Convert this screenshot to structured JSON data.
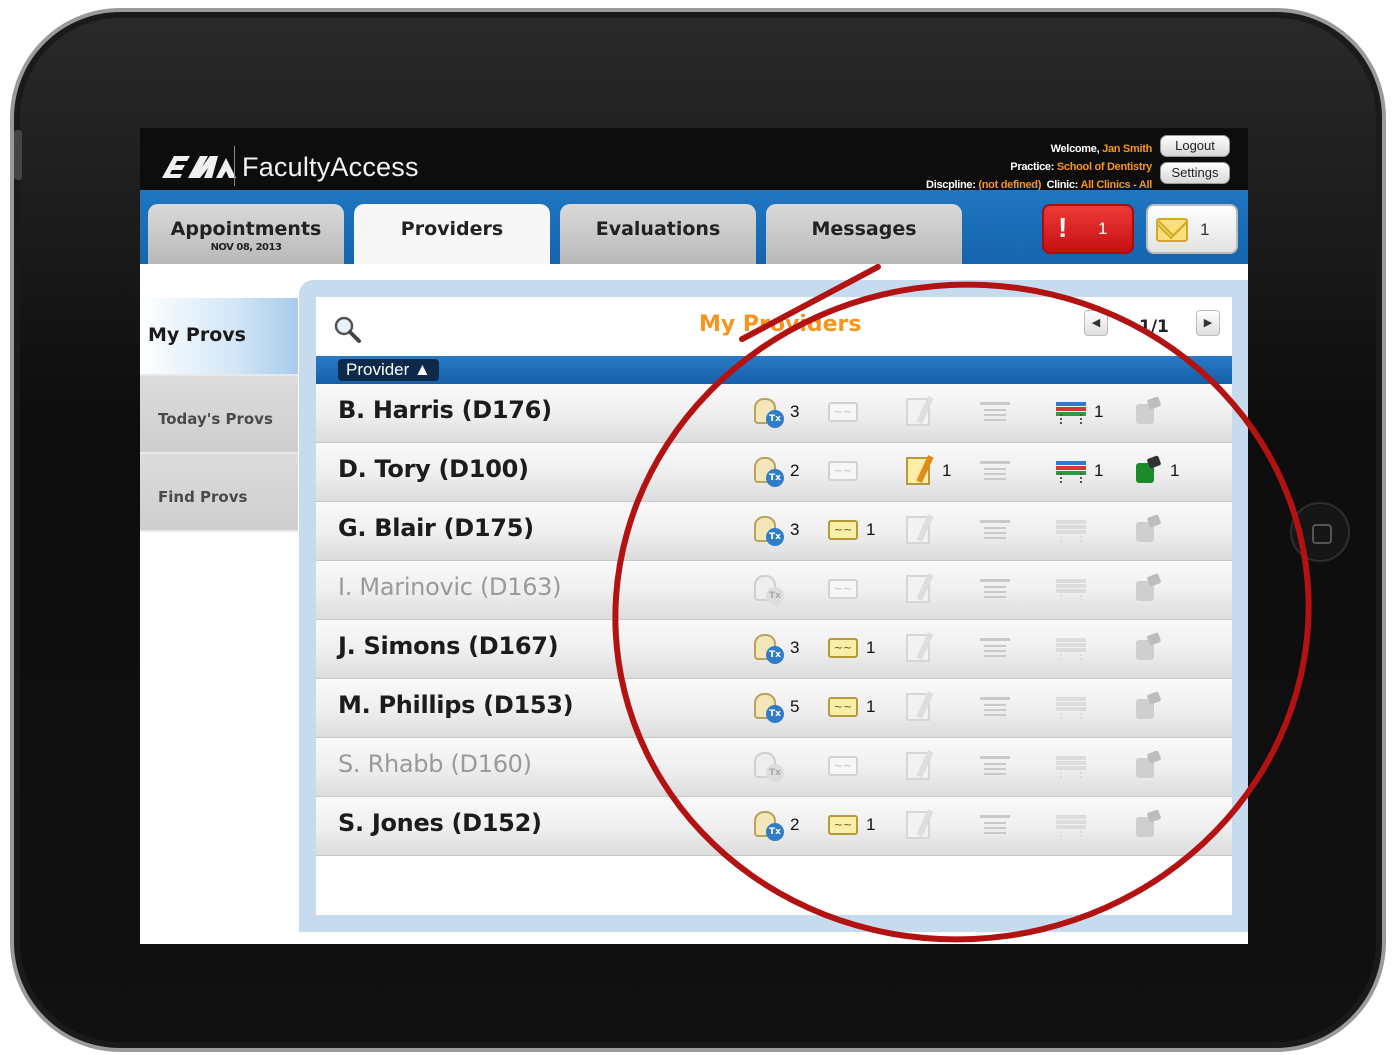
{
  "header": {
    "app_title": "FacultyAccess",
    "welcome_label": "Welcome,",
    "welcome_value": "Jan Smith",
    "practice_label": "Practice:",
    "practice_value": "School of Dentistry",
    "discipline_label": "Discpline:",
    "discipline_value": "(not defined)",
    "clinic_label": "Clinic:",
    "clinic_value": "All Clinics - All",
    "logout_label": "Logout",
    "settings_label": "Settings"
  },
  "tabs": [
    {
      "label": "Appointments",
      "sub": "NOV 08, 2013"
    },
    {
      "label": "Providers"
    },
    {
      "label": "Evaluations"
    },
    {
      "label": "Messages"
    }
  ],
  "badges": {
    "alerts": "1",
    "messages": "1",
    "alert_symbol": "!"
  },
  "subnav": [
    "My Provs",
    "Today's Provs",
    "Find Provs"
  ],
  "card": {
    "title": "My Providers",
    "page": "1/1",
    "sort_label": "Provider ▲"
  },
  "providers": [
    {
      "name": "B. Harris (D176)",
      "dim": false,
      "tx": "3",
      "sig": "",
      "notes": "",
      "perio": "1",
      "tool": ""
    },
    {
      "name": "D. Tory (D100)",
      "dim": false,
      "tx": "2",
      "sig": "",
      "notes": "1",
      "perio": "1",
      "tool": "1"
    },
    {
      "name": "G. Blair (D175)",
      "dim": false,
      "tx": "3",
      "sig": "1",
      "notes": "",
      "perio": "",
      "tool": ""
    },
    {
      "name": "I. Marinovic (D163)",
      "dim": true,
      "tx": "",
      "sig": "",
      "notes": "",
      "perio": "",
      "tool": ""
    },
    {
      "name": "J. Simons (D167)",
      "dim": false,
      "tx": "3",
      "sig": "1",
      "notes": "",
      "perio": "",
      "tool": ""
    },
    {
      "name": "M. Phillips (D153)",
      "dim": false,
      "tx": "5",
      "sig": "1",
      "notes": "",
      "perio": "",
      "tool": ""
    },
    {
      "name": "S. Rhabb (D160)",
      "dim": true,
      "tx": "",
      "sig": "",
      "notes": "",
      "perio": "",
      "tool": ""
    },
    {
      "name": "S. Jones (D152)",
      "dim": false,
      "tx": "2",
      "sig": "1",
      "notes": "",
      "perio": "",
      "tool": ""
    }
  ],
  "icons": {
    "tx": "tooth-rx-icon",
    "signature": "signature-icon",
    "notes": "notes-icon",
    "chart": "chart-icon",
    "perio": "perio-chart-icon",
    "tool": "instrument-icon"
  },
  "colors": {
    "accent": "#f7941d",
    "tabbar": "#1a6db8",
    "alert": "#d42020",
    "annotation": "#b31212"
  }
}
